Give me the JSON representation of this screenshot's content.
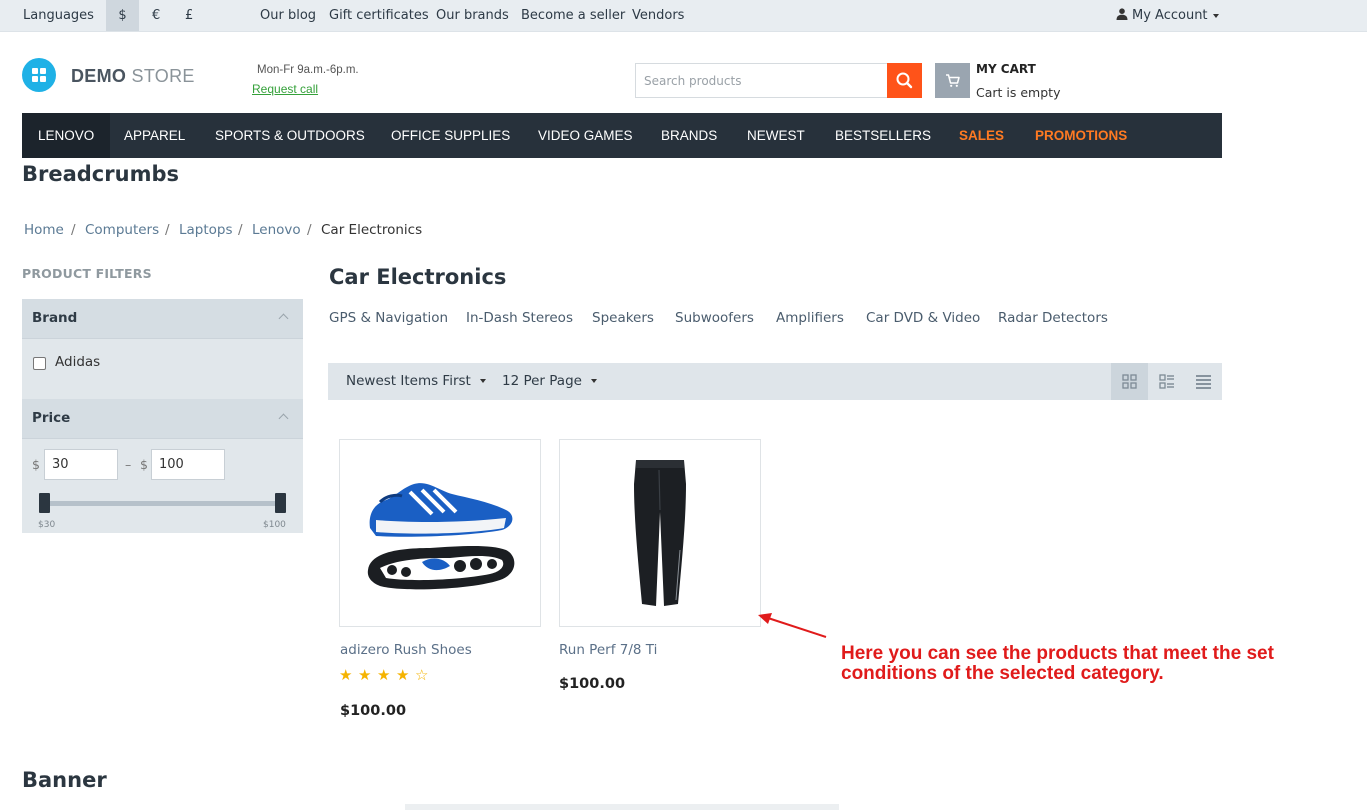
{
  "topbar": {
    "languages": "Languages",
    "currencies": [
      "$",
      "€",
      "£"
    ],
    "links": [
      "Our blog",
      "Gift certificates",
      "Our brands",
      "Become a seller",
      "Vendors"
    ],
    "account": "My Account"
  },
  "header": {
    "logo_demo": "DEMO",
    "logo_store": "STORE",
    "hours": "Mon-Fr 9a.m.-6p.m.",
    "request_call": "Request call",
    "search_placeholder": "Search products",
    "cart_title": "MY CART",
    "cart_status": "Cart is empty"
  },
  "nav": {
    "items": [
      "LENOVO",
      "APPAREL",
      "SPORTS & OUTDOORS",
      "OFFICE SUPPLIES",
      "VIDEO GAMES",
      "BRANDS",
      "NEWEST",
      "BESTSELLERS",
      "SALES",
      "PROMOTIONS"
    ]
  },
  "breadcrumbs_block_title": "Breadcrumbs",
  "breadcrumbs": [
    "Home",
    "Computers",
    "Laptops",
    "Lenovo",
    "Car Electronics"
  ],
  "filters": {
    "title": "PRODUCT FILTERS",
    "brand_title": "Brand",
    "brand_option": "Adidas",
    "price_title": "Price",
    "currency": "$",
    "price_min": "30",
    "price_max": "100",
    "range_sep": "–",
    "slider_min_label": "$30",
    "slider_max_label": "$100"
  },
  "category": {
    "title": "Car Electronics",
    "subcategories": [
      "GPS & Navigation",
      "In-Dash Stereos",
      "Speakers",
      "Subwoofers",
      "Amplifiers",
      "Car DVD & Video",
      "Radar Detectors"
    ],
    "sort_label": "Newest Items First",
    "per_page_label": "12 Per Page",
    "active_view": "grid"
  },
  "products": [
    {
      "name": "adizero Rush Shoes",
      "price": "$100.00",
      "rating": 4
    },
    {
      "name": "Run Perf 7/8 Ti",
      "price": "$100.00"
    }
  ],
  "annotation": "Here you can see the products that meet the set conditions of the selected category.",
  "banner_title": "Banner",
  "colors": {
    "accent_orange": "#ff5319",
    "nav_bg": "#27313b",
    "promo_orange": "#ff7a22",
    "annotation_red": "#e01b1b",
    "logo_blue": "#1fb1e6"
  }
}
